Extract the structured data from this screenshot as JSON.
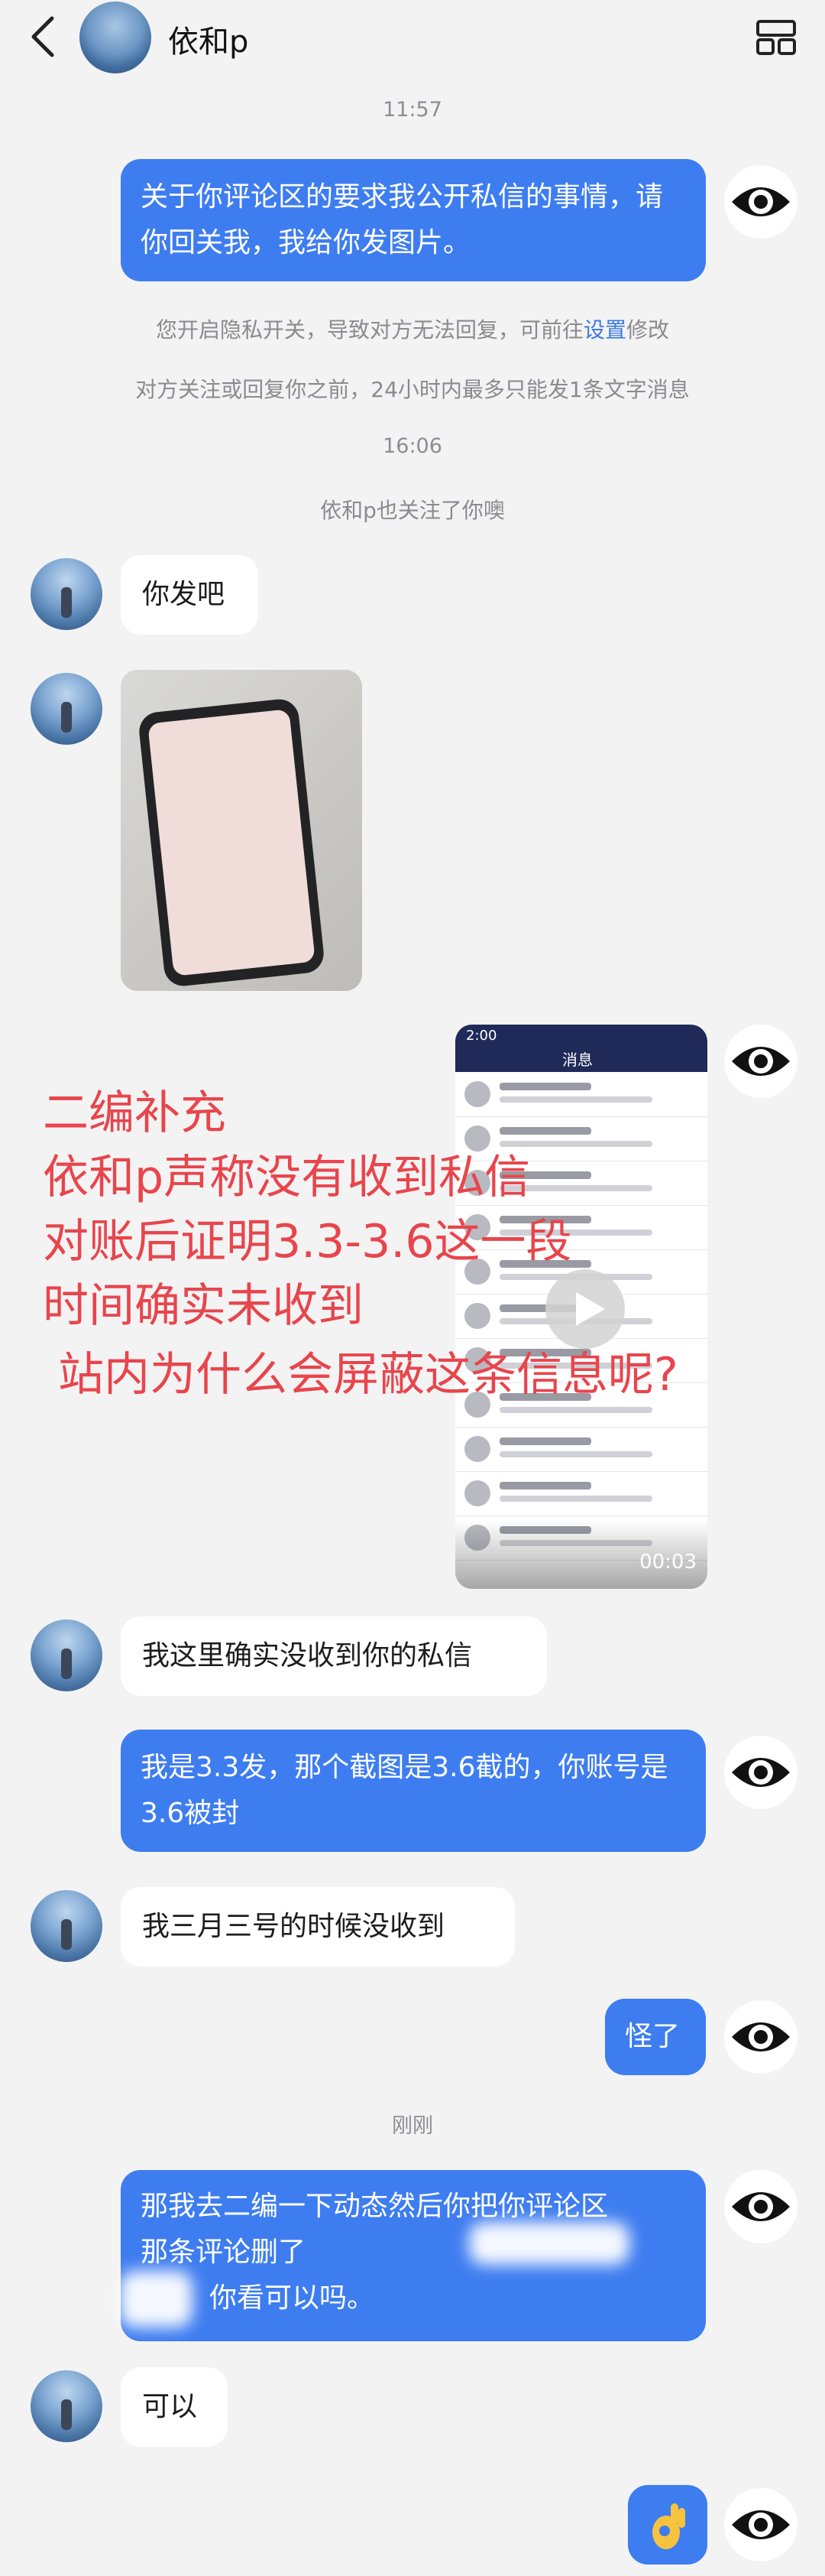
{
  "header": {
    "name": "依和p"
  },
  "times": {
    "t1": "11:57",
    "t2": "16:06",
    "t3": "刚刚"
  },
  "system": {
    "privacy_prefix": "您开启隐私开关，导致对方无法回复，可前往",
    "privacy_link": "设置",
    "privacy_suffix": "修改",
    "limit": "对方关注或回复你之前，24小时内最多只能发1条文字消息",
    "followed": "依和p也关注了你噢"
  },
  "messages": {
    "m1": "关于你评论区的要求我公开私信的事情，请你回关我，我给你发图片。",
    "m2": "你发吧",
    "m3": "我这里确实没收到你的私信",
    "m4": "我是3.3发，那个截图是3.6截的，你账号是3.6被封",
    "m5": "我三月三号的时候没收到",
    "m6": "怪了",
    "m7_l1": "那我去二编一下动态然后你把你评论区",
    "m7_l2": "那条评论删了",
    "m7_l3": "你看可以吗。",
    "m8": "可以"
  },
  "video": {
    "duration": "00:03",
    "status_time": "2:00",
    "title": "消息"
  },
  "overlay": {
    "line1": "二编补充",
    "line2": "依和p声称没有收到私信",
    "line3": "对账后证明3.3-3.6这一段",
    "line4": "时间确实未收到",
    "line5": "站内为什么会屏蔽这条信息呢?"
  },
  "colors": {
    "accent": "#3e7df0",
    "overlay_text": "#e8454c",
    "background": "#f3f3f4"
  }
}
